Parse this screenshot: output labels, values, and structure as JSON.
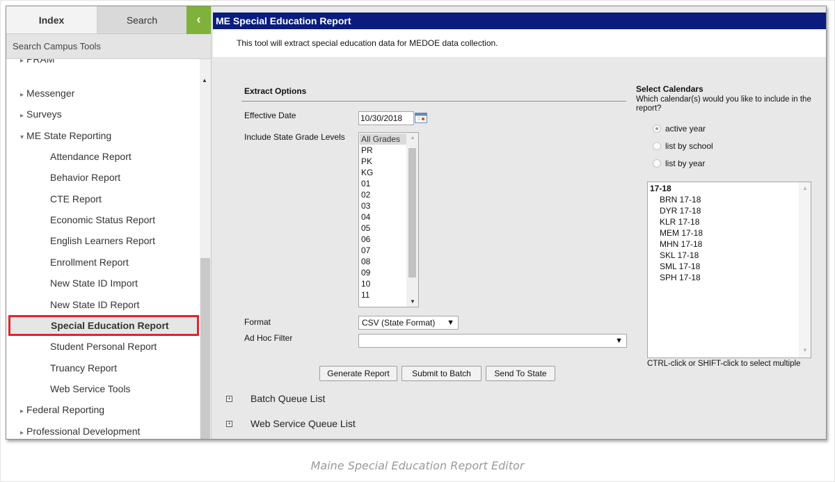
{
  "sidebar": {
    "tabs": {
      "index": "Index",
      "search": "Search"
    },
    "collapse_glyph": "‹",
    "search_tools_label": "Search Campus Tools",
    "items": [
      {
        "label": "PRAM",
        "arrow": "▸"
      },
      {
        "label": "Messenger",
        "arrow": "▸"
      },
      {
        "label": "Surveys",
        "arrow": "▸"
      },
      {
        "label": "ME State Reporting",
        "arrow": "▾"
      },
      {
        "label": "Attendance Report"
      },
      {
        "label": "Behavior Report"
      },
      {
        "label": "CTE Report"
      },
      {
        "label": "Economic Status Report"
      },
      {
        "label": "English Learners Report"
      },
      {
        "label": "Enrollment Report"
      },
      {
        "label": "New State ID Import"
      },
      {
        "label": "New State ID Report"
      },
      {
        "label": "Special Education Report"
      },
      {
        "label": "Student Personal Report"
      },
      {
        "label": "Truancy Report"
      },
      {
        "label": "Web Service Tools"
      },
      {
        "label": "Federal Reporting",
        "arrow": "▸"
      },
      {
        "label": "Professional Development",
        "arrow": "▸"
      }
    ]
  },
  "main": {
    "title": "ME Special Education Report",
    "description": "This tool will extract special education data for MEDOE data collection.",
    "extract_options": {
      "title": "Extract Options",
      "effective_date_label": "Effective Date",
      "effective_date_value": "10/30/2018",
      "grade_levels_label": "Include State Grade Levels",
      "grade_levels": [
        "All Grades",
        "PR",
        "PK",
        "KG",
        "01",
        "02",
        "03",
        "04",
        "05",
        "06",
        "07",
        "08",
        "09",
        "10",
        "11"
      ],
      "selected_grade": "All Grades",
      "format_label": "Format",
      "format_value": "CSV (State Format)",
      "adhoc_label": "Ad Hoc Filter",
      "adhoc_value": ""
    },
    "select_calendars": {
      "title": "Select Calendars",
      "question": "Which calendar(s) would you like to include in the report?",
      "options": [
        "active year",
        "list by school",
        "list by year"
      ],
      "selected_option": "active year",
      "year": "17-18",
      "calendars": [
        "BRN 17-18",
        "DYR 17-18",
        "KLR 17-18",
        "MEM 17-18",
        "MHN 17-18",
        "SKL 17-18",
        "SML 17-18",
        "SPH 17-18"
      ],
      "hint": "CTRL-click or SHIFT-click to select multiple"
    },
    "buttons": {
      "generate": "Generate Report",
      "batch": "Submit to Batch",
      "send": "Send To State"
    },
    "queues": {
      "batch": "Batch Queue List",
      "web_service": "Web Service Queue List"
    },
    "expander_glyph": "+"
  },
  "caption": "Maine Special Education Report Editor",
  "colors": {
    "title_bar": "#0b1c7e",
    "collapse_button": "#7fb23a",
    "selection_outline": "#e0242a"
  }
}
